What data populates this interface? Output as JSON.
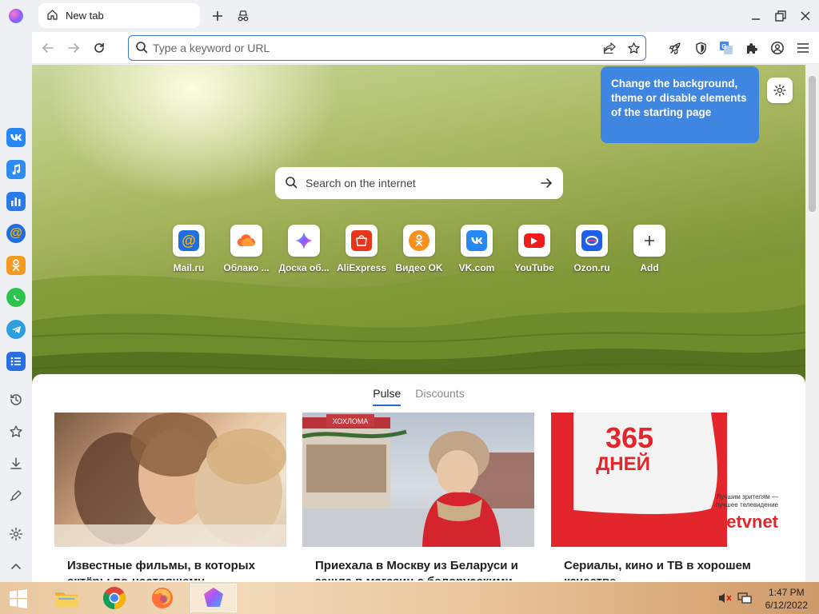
{
  "tab": {
    "title": "New tab"
  },
  "address": {
    "placeholder": "Type a keyword or URL"
  },
  "tooltip": {
    "text": "Change the background, theme or disable elements of the starting page"
  },
  "search": {
    "placeholder": "Search on the internet"
  },
  "tiles": [
    {
      "label": "Mail.ru",
      "icon": "mailru-icon"
    },
    {
      "label": "Облако ...",
      "icon": "cloud-icon"
    },
    {
      "label": "Доска об...",
      "icon": "star-icon"
    },
    {
      "label": "AliExpress",
      "icon": "aliexpress-icon"
    },
    {
      "label": "Видео OK",
      "icon": "odnoklassniki-icon"
    },
    {
      "label": "VK.com",
      "icon": "vk-icon"
    },
    {
      "label": "YouTube",
      "icon": "youtube-icon"
    },
    {
      "label": "Ozon.ru",
      "icon": "ozon-icon"
    },
    {
      "label": "Add",
      "icon": "plus-icon"
    }
  ],
  "feed": {
    "tabs": [
      "Pulse",
      "Discounts"
    ],
    "cards": [
      {
        "title": "Известные фильмы, в которых актёры по-настоящему"
      },
      {
        "title": "Приехала в Москву из Беларуси и зашла в магазин с белорусскими"
      },
      {
        "title": "Сериалы, кино и ТВ в хорошем качестве"
      }
    ],
    "ad": {
      "headline_number": "365",
      "headline_word": "ДНЕЙ",
      "tagline_line1": "Лучшим зрителям —",
      "tagline_line2": "лучшее телевидение",
      "brand": "etvnet"
    },
    "photo_sign": "ХОХЛОМА"
  },
  "taskbar": {
    "time": "1:47 PM",
    "date": "6/12/2022"
  },
  "colors": {
    "accent": "#3f86e0",
    "tab_underline": "#2a66d4",
    "omnibox_border": "#3a74d8"
  }
}
